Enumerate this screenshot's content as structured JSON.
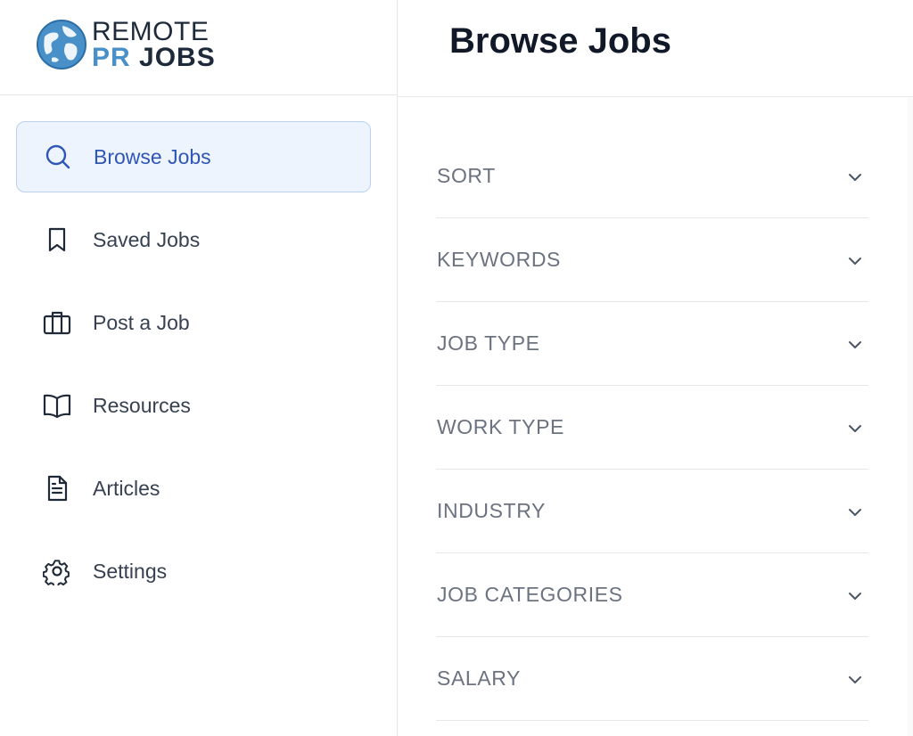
{
  "brand": {
    "line1": "REMOTE",
    "line2_a": "PR",
    "line2_b": "JOBS",
    "colors": {
      "navy": "#1e2a3a",
      "blue": "#4a90c8"
    }
  },
  "header": {
    "title": "Browse Jobs"
  },
  "sidebar": {
    "items": [
      {
        "label": "Browse Jobs",
        "icon": "search-icon",
        "active": true
      },
      {
        "label": "Saved Jobs",
        "icon": "bookmark-icon",
        "active": false
      },
      {
        "label": "Post a Job",
        "icon": "briefcase-icon",
        "active": false
      },
      {
        "label": "Resources",
        "icon": "book-open-icon",
        "active": false
      },
      {
        "label": "Articles",
        "icon": "document-icon",
        "active": false
      },
      {
        "label": "Settings",
        "icon": "gear-icon",
        "active": false
      }
    ]
  },
  "filters": {
    "items": [
      {
        "label": "SORT"
      },
      {
        "label": "KEYWORDS"
      },
      {
        "label": "JOB TYPE"
      },
      {
        "label": "WORK TYPE"
      },
      {
        "label": "INDUSTRY"
      },
      {
        "label": "JOB CATEGORIES"
      },
      {
        "label": "SALARY"
      }
    ]
  },
  "theme": {
    "accent": "#2f55b5",
    "active_bg": "#eef4fd",
    "active_border": "#b9d1f3"
  }
}
